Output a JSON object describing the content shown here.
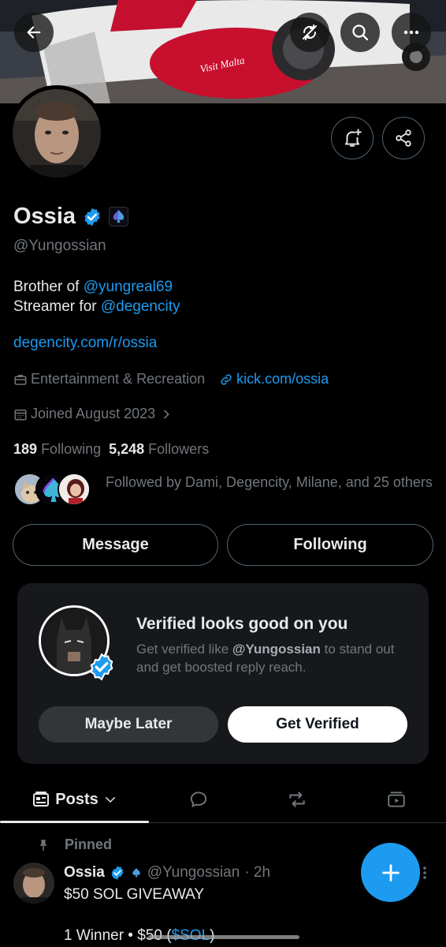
{
  "header": {
    "back_icon": "arrow-left-icon",
    "buttons": [
      "mute-repost-icon",
      "search-icon",
      "more-icon"
    ]
  },
  "banner": {
    "airline_text": "Visit Malta"
  },
  "profile": {
    "name": "Ossia",
    "handle": "@Yungossian",
    "bio_line1_prefix": "Brother of ",
    "bio_line1_link": "@yungreal69",
    "bio_line2_prefix": "Streamer for ",
    "bio_line2_link": "@degencity",
    "website": "degencity.com/r/ossia",
    "category": "Entertainment & Recreation",
    "external_link": "kick.com/ossia",
    "joined": "Joined August 2023",
    "following_count": "189",
    "following_label": "Following",
    "followers_count": "5,248",
    "followers_label": "Followers",
    "followed_by": "Followed by Dami, Degencity, Milane, and 25 others"
  },
  "actions": {
    "message": "Message",
    "following": "Following"
  },
  "verified_card": {
    "title": "Verified looks good on you",
    "text_prefix": "Get verified like ",
    "text_handle": "@Yungossian",
    "text_suffix": " to stand out and get boosted reply reach.",
    "maybe_later": "Maybe Later",
    "get_verified": "Get Verified"
  },
  "tabs": {
    "posts": "Posts"
  },
  "post": {
    "pinned_label": "Pinned",
    "author_name": "Ossia",
    "author_handle": "@Yungossian",
    "time": "· 2h",
    "line1": "$50 SOL GIVEAWAY",
    "line2_prefix": "1 Winner • $50 (",
    "line2_link": "$SOL",
    "line2_suffix": ")"
  },
  "colors": {
    "accent": "#1d9bf0",
    "background": "#000000",
    "muted": "#71767b",
    "text": "#e7e9ea"
  }
}
